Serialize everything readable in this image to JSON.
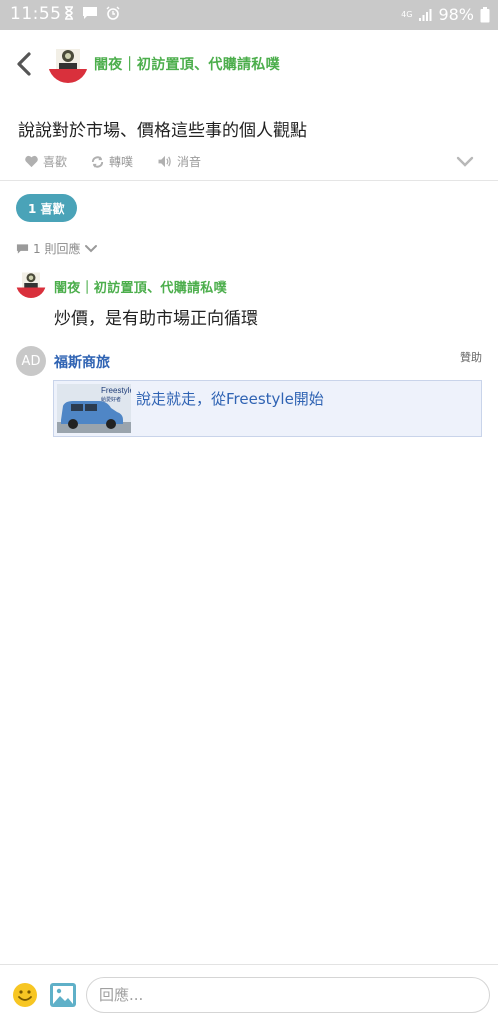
{
  "status_bar": {
    "time": "11:55",
    "battery": "98%",
    "network": "4G"
  },
  "header": {
    "author": "闇夜｜初訪置頂、代購請私噗"
  },
  "post": {
    "text": "說說對於市場、價格這些事的個人觀點"
  },
  "actions": {
    "like": "喜歡",
    "replurk": "轉噗",
    "mute": "消音"
  },
  "likes": {
    "label": "1 喜歡"
  },
  "replies": {
    "count_label": "1 則回應"
  },
  "comment": {
    "author": "闇夜｜初訪置頂、代購請私噗",
    "text": "炒價，是有助市場正向循環"
  },
  "ad": {
    "avatar_text": "AD",
    "advertiser": "福斯商旅",
    "sponsored": "贊助",
    "title": "說走就走，從Freestyle開始",
    "thumb_text": "Freestyle",
    "thumb_subtext": "給愛好者"
  },
  "composer": {
    "placeholder": "回應..."
  },
  "colors": {
    "author_green": "#4cae4c",
    "accent_teal": "#4aa3b8",
    "ad_blue": "#2f63b3",
    "status_bar": "#c9c9c9"
  }
}
